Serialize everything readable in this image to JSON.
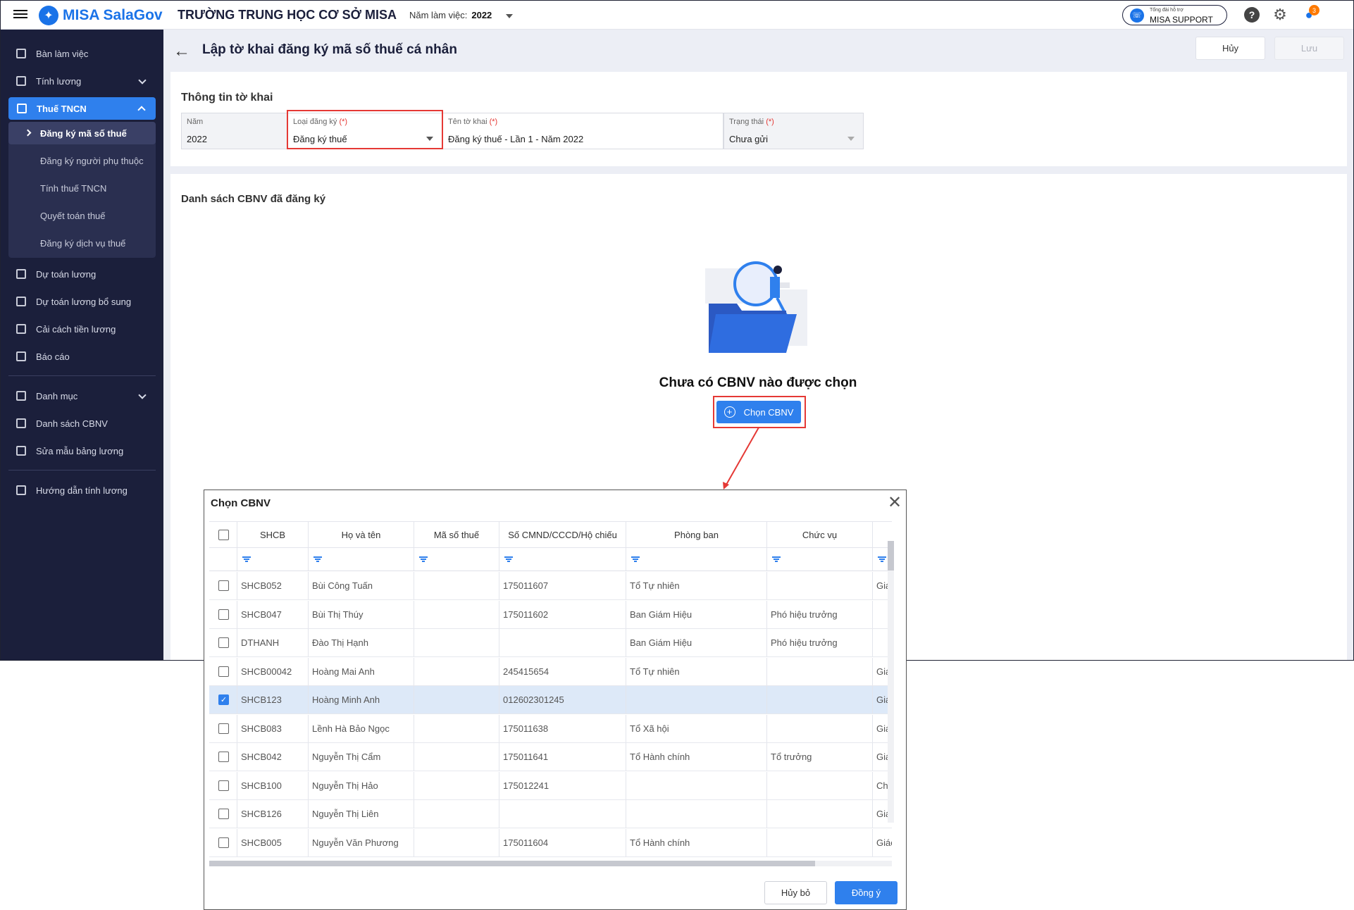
{
  "app": {
    "logo_text": "MISA SalaGov",
    "school_name": "TRƯỜNG TRUNG HỌC CƠ SỞ MISA",
    "work_year_label": "Năm làm việc:",
    "work_year_value": "2022",
    "support_small": "Tổng đài hỗ trợ",
    "support_big": "MISA SUPPORT",
    "notification_count": "3"
  },
  "sidebar": {
    "items": [
      {
        "label": "Bàn làm việc"
      },
      {
        "label": "Tính lương"
      },
      {
        "label": "Thuế TNCN"
      },
      {
        "label": "Dự toán lương"
      },
      {
        "label": "Dự toán lương bổ sung"
      },
      {
        "label": "Cải cách tiền lương"
      },
      {
        "label": "Báo cáo"
      },
      {
        "label": "Danh mục"
      },
      {
        "label": "Danh sách CBNV"
      },
      {
        "label": "Sửa mẫu bảng lương"
      },
      {
        "label": "Hướng dẫn tính lương"
      }
    ],
    "sub_items": [
      {
        "label": "Đăng ký mã số thuế"
      },
      {
        "label": "Đăng ký người phụ thuộc"
      },
      {
        "label": "Tính thuế TNCN"
      },
      {
        "label": "Quyết toán thuế"
      },
      {
        "label": "Đăng ký dịch vụ thuế"
      }
    ]
  },
  "header": {
    "title": "Lập tờ khai đăng ký mã số thuế cá nhân",
    "cancel_label": "Hủy",
    "save_label": "Lưu"
  },
  "form": {
    "section_title": "Thông tin tờ khai",
    "required_mark": "(*)",
    "year_label": "Năm",
    "year_value": "2022",
    "reg_type_label": "Loại đăng ký",
    "reg_type_value": "Đăng ký thuế",
    "declaration_name_label": "Tên tờ khai",
    "declaration_name_value": "Đăng ký thuế - Lần 1 - Năm 2022",
    "status_label": "Trạng thái",
    "status_value": "Chưa gửi"
  },
  "list": {
    "section_title": "Danh sách CBNV đã đăng ký",
    "empty_text": "Chưa có CBNV nào được chọn",
    "choose_label": "Chọn CBNV"
  },
  "dialog": {
    "title": "Chọn CBNV",
    "columns": [
      "SHCB",
      "Họ và tên",
      "Mã số thuế",
      "Số CMND/CCCD/Hộ chiếu",
      "Phòng ban",
      "Chức vụ"
    ],
    "rows": [
      {
        "shcb": "SHCB052",
        "name": "Bùi Công Tuấn",
        "tax": "",
        "id": "175011607",
        "dept": "Tổ Tự nhiên",
        "pos": "",
        "extra": "Giáo"
      },
      {
        "shcb": "SHCB047",
        "name": "Bùi Thị Thúy",
        "tax": "",
        "id": "175011602",
        "dept": "Ban Giám Hiệu",
        "pos": "Phó hiệu trưởng",
        "extra": ""
      },
      {
        "shcb": "DTHANH",
        "name": "Đào Thị Hạnh",
        "tax": "",
        "id": "",
        "dept": "Ban Giám Hiệu",
        "pos": "Phó hiệu trưởng",
        "extra": ""
      },
      {
        "shcb": "SHCB00042",
        "name": "Hoàng Mai Anh",
        "tax": "",
        "id": "245415654",
        "dept": "Tổ Tự nhiên",
        "pos": "",
        "extra": "Giáo"
      },
      {
        "shcb": "SHCB123",
        "name": "Hoàng Minh Anh",
        "tax": "",
        "id": "012602301245",
        "dept": "",
        "pos": "",
        "extra": "Giáo",
        "selected": true
      },
      {
        "shcb": "SHCB083",
        "name": "Lềnh Hà Bảo Ngọc",
        "tax": "",
        "id": "175011638",
        "dept": "Tổ Xã hội",
        "pos": "",
        "extra": "Giáo"
      },
      {
        "shcb": "SHCB042",
        "name": "Nguyễn Thị Cẩm",
        "tax": "",
        "id": "175011641",
        "dept": "Tổ Hành chính",
        "pos": "Tổ trưởng",
        "extra": "Giáo"
      },
      {
        "shcb": "SHCB100",
        "name": "Nguyễn Thị Hảo",
        "tax": "",
        "id": "175012241",
        "dept": "",
        "pos": "",
        "extra": "Chuy"
      },
      {
        "shcb": "SHCB126",
        "name": "Nguyễn Thị Liên",
        "tax": "",
        "id": "",
        "dept": "",
        "pos": "",
        "extra": "Giáo"
      },
      {
        "shcb": "SHCB005",
        "name": "Nguyễn Văn Phương",
        "tax": "",
        "id": "175011604",
        "dept": "Tổ Hành chính",
        "pos": "",
        "extra": "Giáo"
      }
    ],
    "cancel_label": "Hủy bỏ",
    "ok_label": "Đồng ý"
  },
  "colors": {
    "sidebar_bg": "#1b1f3b",
    "accent": "#2f80ed",
    "highlight_red": "#e53935"
  }
}
